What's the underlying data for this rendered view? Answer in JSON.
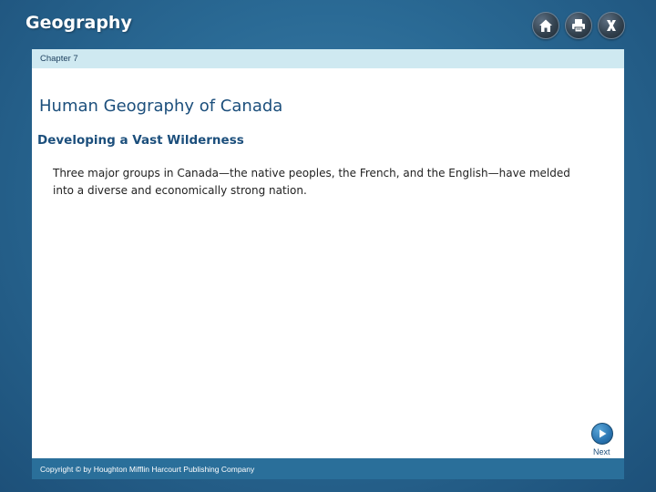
{
  "app": {
    "title": "Geography"
  },
  "toolbar": {
    "buttons": [
      {
        "icon": "home-icon"
      },
      {
        "icon": "print-icon"
      },
      {
        "icon": "close-icon"
      }
    ]
  },
  "header": {
    "chapter": "Chapter 7"
  },
  "main": {
    "title": "Human Geography of Canada",
    "section_title": "Developing a Vast Wilderness",
    "body": "Three major groups in Canada—the native peoples, the French, and the English—have melded into a diverse and economically strong nation."
  },
  "navigation": {
    "next_label": "Next",
    "next_icon": "play-icon"
  },
  "footer": {
    "copyright": "Copyright © by Houghton Mifflin Harcourt Publishing Company"
  },
  "colors": {
    "background": "#2a6a95",
    "chapter_bar": "#cfe9f1",
    "title_text": "#1c4f7c",
    "footer_bar": "#2a6f9a",
    "button_dark": "#33424f",
    "next_button": "#2a74b0"
  }
}
